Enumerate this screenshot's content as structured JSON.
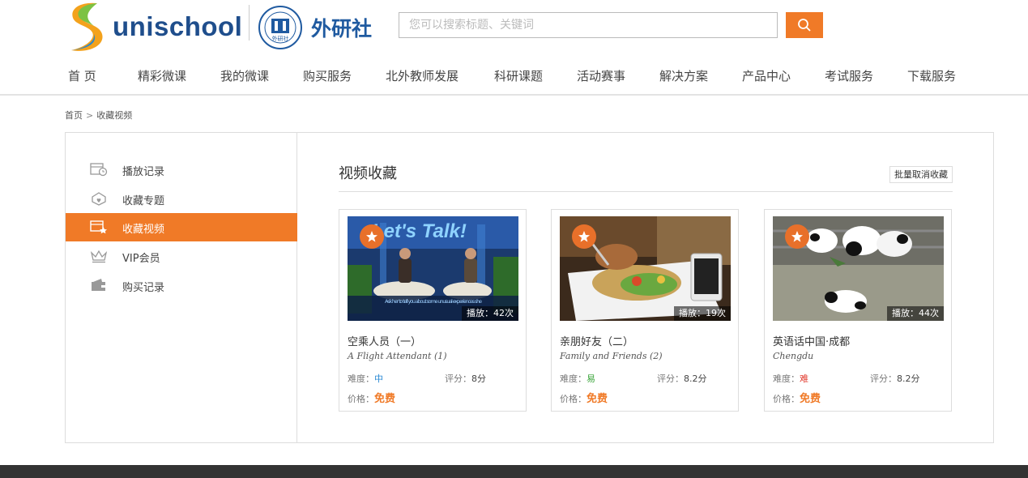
{
  "header": {
    "logo_text": "unischool",
    "brand_cn": "外研社",
    "seal_text": "外研社",
    "search_placeholder": "您可以搜索标题、关键词",
    "search_button_icon": "search-icon",
    "accent_color": "#f07a27"
  },
  "nav": [
    {
      "label": "首  页"
    },
    {
      "label": "精彩微课"
    },
    {
      "label": "我的微课"
    },
    {
      "label": "购买服务"
    },
    {
      "label": "北外教师发展"
    },
    {
      "label": "科研课题"
    },
    {
      "label": "活动赛事"
    },
    {
      "label": "解决方案"
    },
    {
      "label": "产品中心"
    },
    {
      "label": "考试服务"
    },
    {
      "label": "下载服务"
    }
  ],
  "breadcrumb": {
    "home": "首页",
    "separator": ">",
    "current": "收藏视频"
  },
  "sidebar": [
    {
      "label": "播放记录",
      "icon": "play-history-icon",
      "active": false
    },
    {
      "label": "收藏专题",
      "icon": "favorite-topic-icon",
      "active": false
    },
    {
      "label": "收藏视频",
      "icon": "favorite-video-icon",
      "active": true
    },
    {
      "label": "VIP会员",
      "icon": "crown-icon",
      "active": false
    },
    {
      "label": "购买记录",
      "icon": "wallet-icon",
      "active": false
    }
  ],
  "content": {
    "title": "视频收藏",
    "batch_button": "批量取消收藏"
  },
  "cards": [
    {
      "title": "空乘人员（一）",
      "subtitle": "A Flight Attendant (1)",
      "plays": "播放：42次",
      "difficulty_label": "难度：",
      "difficulty": "中",
      "difficulty_color": "#2a8ad4",
      "score_label": "评分：",
      "score": "8分",
      "price_label": "价格：",
      "price": "免费",
      "thumb_overlay": "Let's Talk!",
      "thumb_caption": "Ask her to tell you about some unusual experiences she"
    },
    {
      "title": "亲朋好友（二）",
      "subtitle": "Family and Friends (2)",
      "plays": "播放：19次",
      "difficulty_label": "难度：",
      "difficulty": "易",
      "difficulty_color": "#3aa43a",
      "score_label": "评分：",
      "score": "8.2分",
      "price_label": "价格：",
      "price": "免费"
    },
    {
      "title": "英语话中国·成都",
      "subtitle": "Chengdu",
      "plays": "播放：44次",
      "difficulty_label": "难度：",
      "difficulty": "难",
      "difficulty_color": "#e23b2e",
      "score_label": "评分：",
      "score": "8.2分",
      "price_label": "价格：",
      "price": "免费"
    }
  ]
}
